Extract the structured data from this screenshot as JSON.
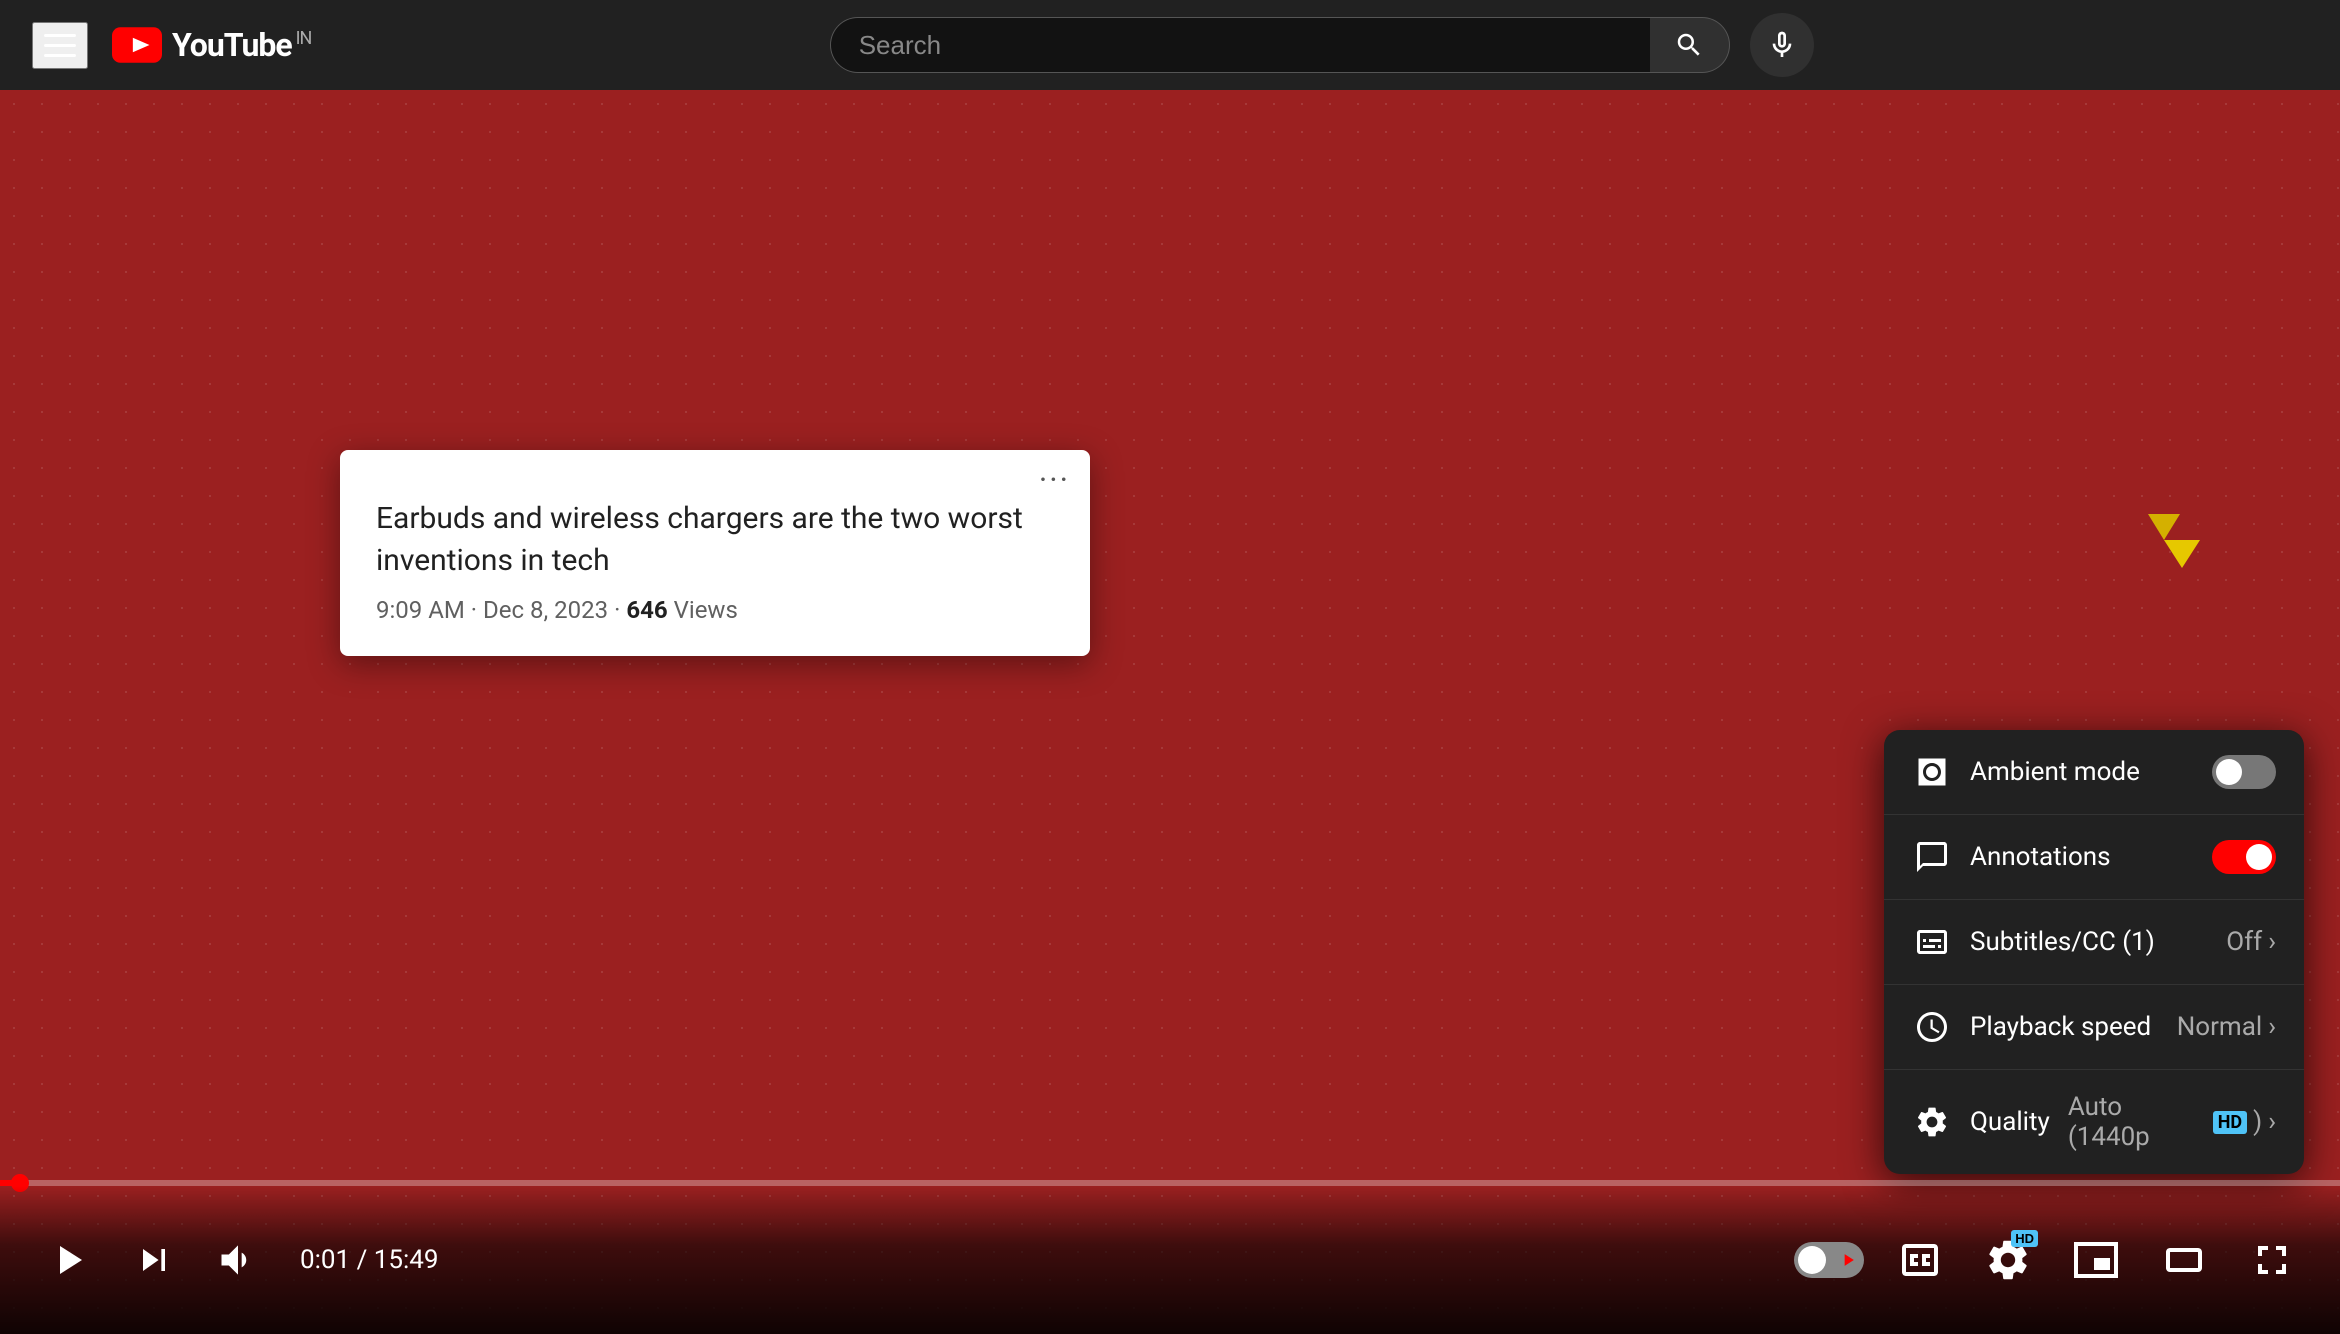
{
  "header": {
    "menu_label": "Menu",
    "logo_text": "YouTube",
    "country_code": "IN",
    "search_placeholder": "Search",
    "search_btn_label": "Search",
    "mic_btn_label": "Search with your voice"
  },
  "player": {
    "progress_percent": 0.9,
    "time_current": "0:01",
    "time_total": "15:49",
    "controls": {
      "play_label": "Play",
      "next_label": "Next",
      "volume_label": "Volume",
      "cc_label": "Subtitles/CC",
      "settings_label": "Settings",
      "miniplayer_label": "Miniplayer",
      "theater_label": "Theater mode",
      "fullscreen_label": "Fullscreen",
      "hd_badge": "HD"
    }
  },
  "info_card": {
    "title": "Earbuds and wireless chargers are the two worst inventions in tech",
    "meta": "9:09 AM · Dec 8, 2023 · ",
    "views_count": "646",
    "views_label": "Views",
    "dots_label": "More options"
  },
  "settings_menu": {
    "items": [
      {
        "id": "ambient-mode",
        "label": "Ambient mode",
        "type": "toggle",
        "value": "off",
        "icon": "ambient-icon"
      },
      {
        "id": "annotations",
        "label": "Annotations",
        "type": "toggle",
        "value": "on",
        "icon": "annotations-icon"
      },
      {
        "id": "subtitles",
        "label": "Subtitles/CC (1)",
        "type": "chevron",
        "value": "Off",
        "icon": "cc-icon"
      },
      {
        "id": "playback-speed",
        "label": "Playback speed",
        "type": "chevron",
        "value": "Normal",
        "icon": "speed-icon"
      },
      {
        "id": "quality",
        "label": "Quality",
        "type": "chevron",
        "value": "Auto (1440p",
        "value_badge": "HD",
        "icon": "quality-icon"
      }
    ]
  }
}
